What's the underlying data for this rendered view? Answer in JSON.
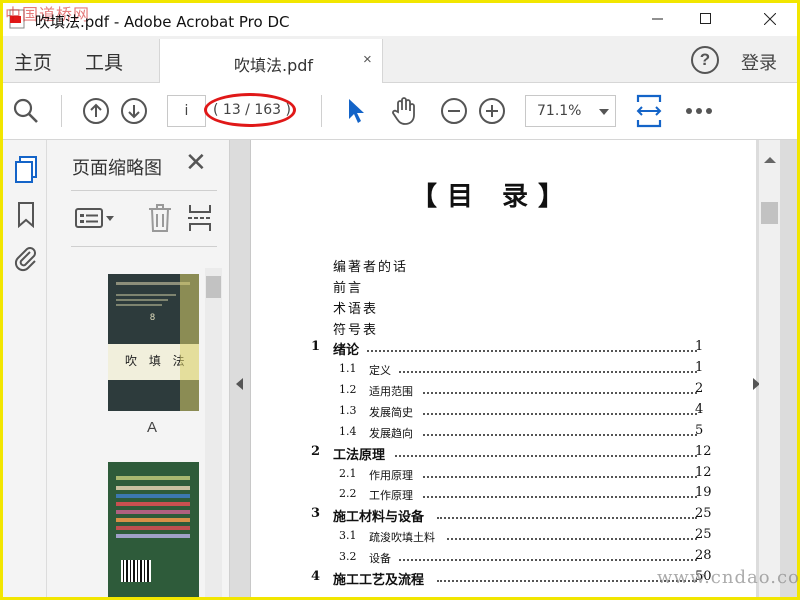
{
  "watermark_top": "中国道桥网",
  "window": {
    "title": "吹填法.pdf - Adobe Acrobat Pro DC",
    "minimize_icon": "minimize-icon",
    "maximize_icon": "maximize-icon",
    "close_icon": "close-icon"
  },
  "nav": {
    "home": "主页",
    "tools": "工具",
    "doc_tab": "吹填法.pdf",
    "doc_tab_close": "×",
    "help": "?",
    "login": "登录"
  },
  "toolbar": {
    "page_input_value": "i",
    "page_count": "( 13 / 163 )",
    "zoom": "71.1%",
    "accent_color": "#1464c8",
    "highlight_color": "#e01818"
  },
  "thumbnails": {
    "title": "页面缩略图",
    "close": "✕",
    "page_label": "A",
    "cover_title": "吹 填 法",
    "cover_number": "8"
  },
  "document": {
    "heading": "【目 录】",
    "entries": [
      {
        "num": "",
        "text": "编著者的话",
        "page": "",
        "level": 0
      },
      {
        "num": "",
        "text": "前言",
        "page": "",
        "level": 0
      },
      {
        "num": "",
        "text": "术语表",
        "page": "",
        "level": 0
      },
      {
        "num": "",
        "text": "符号表",
        "page": "",
        "level": 0
      },
      {
        "num": "1",
        "text": "绪论",
        "page": "1",
        "level": 1
      },
      {
        "num": "1.1",
        "text": "定义",
        "page": "1",
        "level": 2
      },
      {
        "num": "1.2",
        "text": "适用范围",
        "page": "2",
        "level": 2
      },
      {
        "num": "1.3",
        "text": "发展简史",
        "page": "4",
        "level": 2
      },
      {
        "num": "1.4",
        "text": "发展趋向",
        "page": "5",
        "level": 2
      },
      {
        "num": "2",
        "text": "工法原理",
        "page": "12",
        "level": 1
      },
      {
        "num": "2.1",
        "text": "作用原理",
        "page": "12",
        "level": 2
      },
      {
        "num": "2.2",
        "text": "工作原理",
        "page": "19",
        "level": 2
      },
      {
        "num": "3",
        "text": "施工材料与设备",
        "page": "25",
        "level": 1
      },
      {
        "num": "3.1",
        "text": "疏浚吹填土料",
        "page": "25",
        "level": 2
      },
      {
        "num": "3.2",
        "text": "设备",
        "page": "28",
        "level": 2
      },
      {
        "num": "4",
        "text": "施工工艺及流程",
        "page": "50",
        "level": 1
      }
    ]
  },
  "watermark_bottom": "www.cndao.com"
}
